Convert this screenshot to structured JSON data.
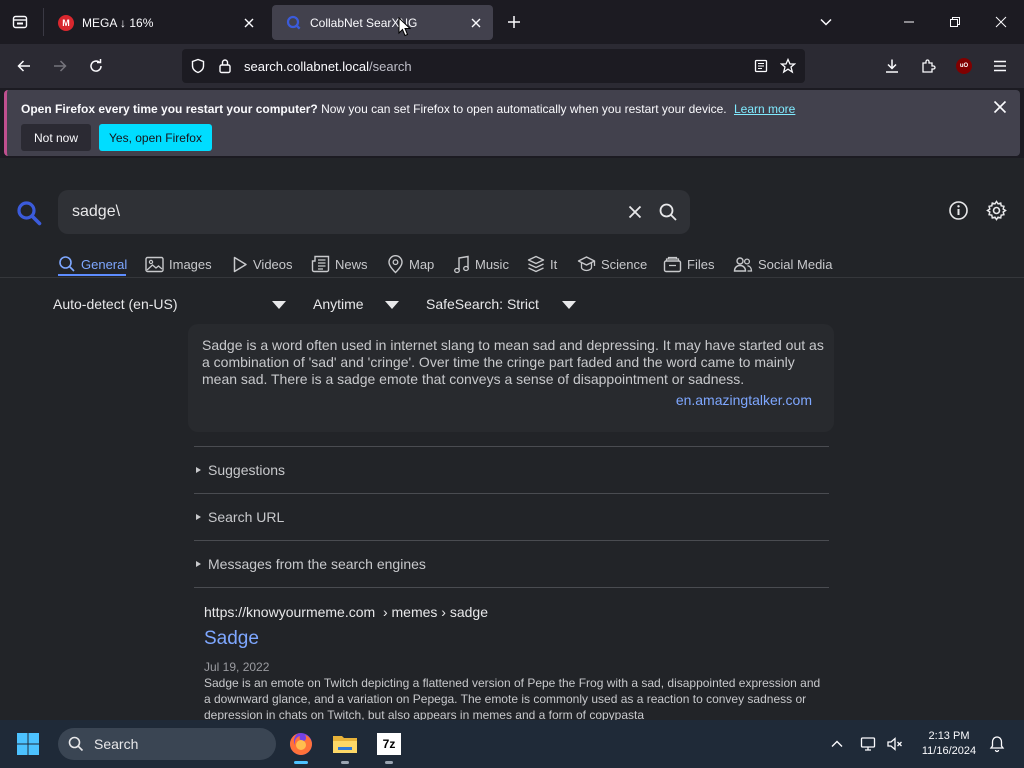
{
  "browser": {
    "tabs": [
      {
        "title": "MEGA ↓ 16%"
      },
      {
        "title": "CollabNet SearXNG"
      }
    ],
    "url": {
      "host": "search.collabnet.local",
      "path": "/search"
    }
  },
  "notification": {
    "bold": "Open Firefox every time you restart your computer?",
    "text": "Now you can set Firefox to open automatically when you restart your device.",
    "link": "Learn more",
    "not_now": "Not now",
    "yes": "Yes, open Firefox"
  },
  "search": {
    "query": "sadge\\"
  },
  "categories": [
    {
      "label": "General",
      "icon": "search-icon"
    },
    {
      "label": "Images",
      "icon": "image-icon"
    },
    {
      "label": "Videos",
      "icon": "play-icon"
    },
    {
      "label": "News",
      "icon": "newspaper-icon"
    },
    {
      "label": "Map",
      "icon": "map-pin-icon"
    },
    {
      "label": "Music",
      "icon": "music-icon"
    },
    {
      "label": "It",
      "icon": "layers-icon"
    },
    {
      "label": "Science",
      "icon": "science-icon"
    },
    {
      "label": "Files",
      "icon": "files-icon"
    },
    {
      "label": "Social Media",
      "icon": "people-icon"
    }
  ],
  "filters": {
    "language": "Auto-detect (en-US)",
    "time": "Anytime",
    "safesearch": "SafeSearch: Strict"
  },
  "infobox": {
    "text": "Sadge is a word often used in internet slang to mean sad and depressing. It may have started out as a combination of 'sad' and 'cringe'. Over time the cringe part faded and the word came to mainly mean sad. There is a sadge emote that conveys a sense of disappointment or sadness.",
    "source": "en.amazingtalker.com"
  },
  "sections": {
    "suggestions": "Suggestions",
    "search_url": "Search URL",
    "messages": "Messages from the search engines"
  },
  "result": {
    "url": "https://knowyourmeme.com",
    "breadcrumb": "› memes › sadge",
    "title": "Sadge",
    "date": "Jul 19, 2022",
    "snippet": "Sadge is an emote on Twitch depicting a flattened version of Pepe the Frog with a sad, disappointed expression and a downward glance, and a variation on Pepega. The emote is commonly used as a reaction to convey sadness or depression in chats on Twitch, but also appears in memes and a form of copypasta"
  },
  "taskbar": {
    "search_label": "Search",
    "time": "2:13 PM",
    "date": "11/16/2024",
    "apps": [
      "firefox-icon",
      "file-explorer-icon",
      "7zip-icon"
    ]
  }
}
